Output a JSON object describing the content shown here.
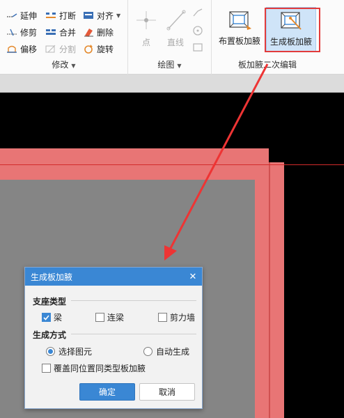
{
  "ribbon": {
    "modify": {
      "label": "修改",
      "items": {
        "extend": "延伸",
        "break": "打断",
        "align": "对齐",
        "trim": "修剪",
        "merge": "合并",
        "delete": "删除",
        "offset": "偏移",
        "split": "分割",
        "rotate": "旋转"
      }
    },
    "draw": {
      "label": "绘图",
      "items": {
        "point": "点",
        "line": "直线"
      }
    },
    "haunch": {
      "label": "板加腋二次编辑",
      "place_button": "布置板加腋",
      "generate_button": "生成板加腋"
    }
  },
  "dialog": {
    "title": "生成板加腋",
    "support_section": "支座类型",
    "support_options": [
      {
        "label": "梁",
        "checked": true
      },
      {
        "label": "连梁",
        "checked": false
      },
      {
        "label": "剪力墙",
        "checked": false
      }
    ],
    "method_section": "生成方式",
    "method_options": [
      {
        "label": "选择图元",
        "selected": true
      },
      {
        "label": "自动生成",
        "selected": false
      }
    ],
    "override_label": "覆盖同位置同类型板加腋",
    "override_checked": false,
    "ok_label": "确定",
    "cancel_label": "取消"
  },
  "colors": {
    "accent": "#3a87d4",
    "highlight": "#e23b3b",
    "slab_red": "#e87575",
    "slab_gray": "#858585"
  }
}
